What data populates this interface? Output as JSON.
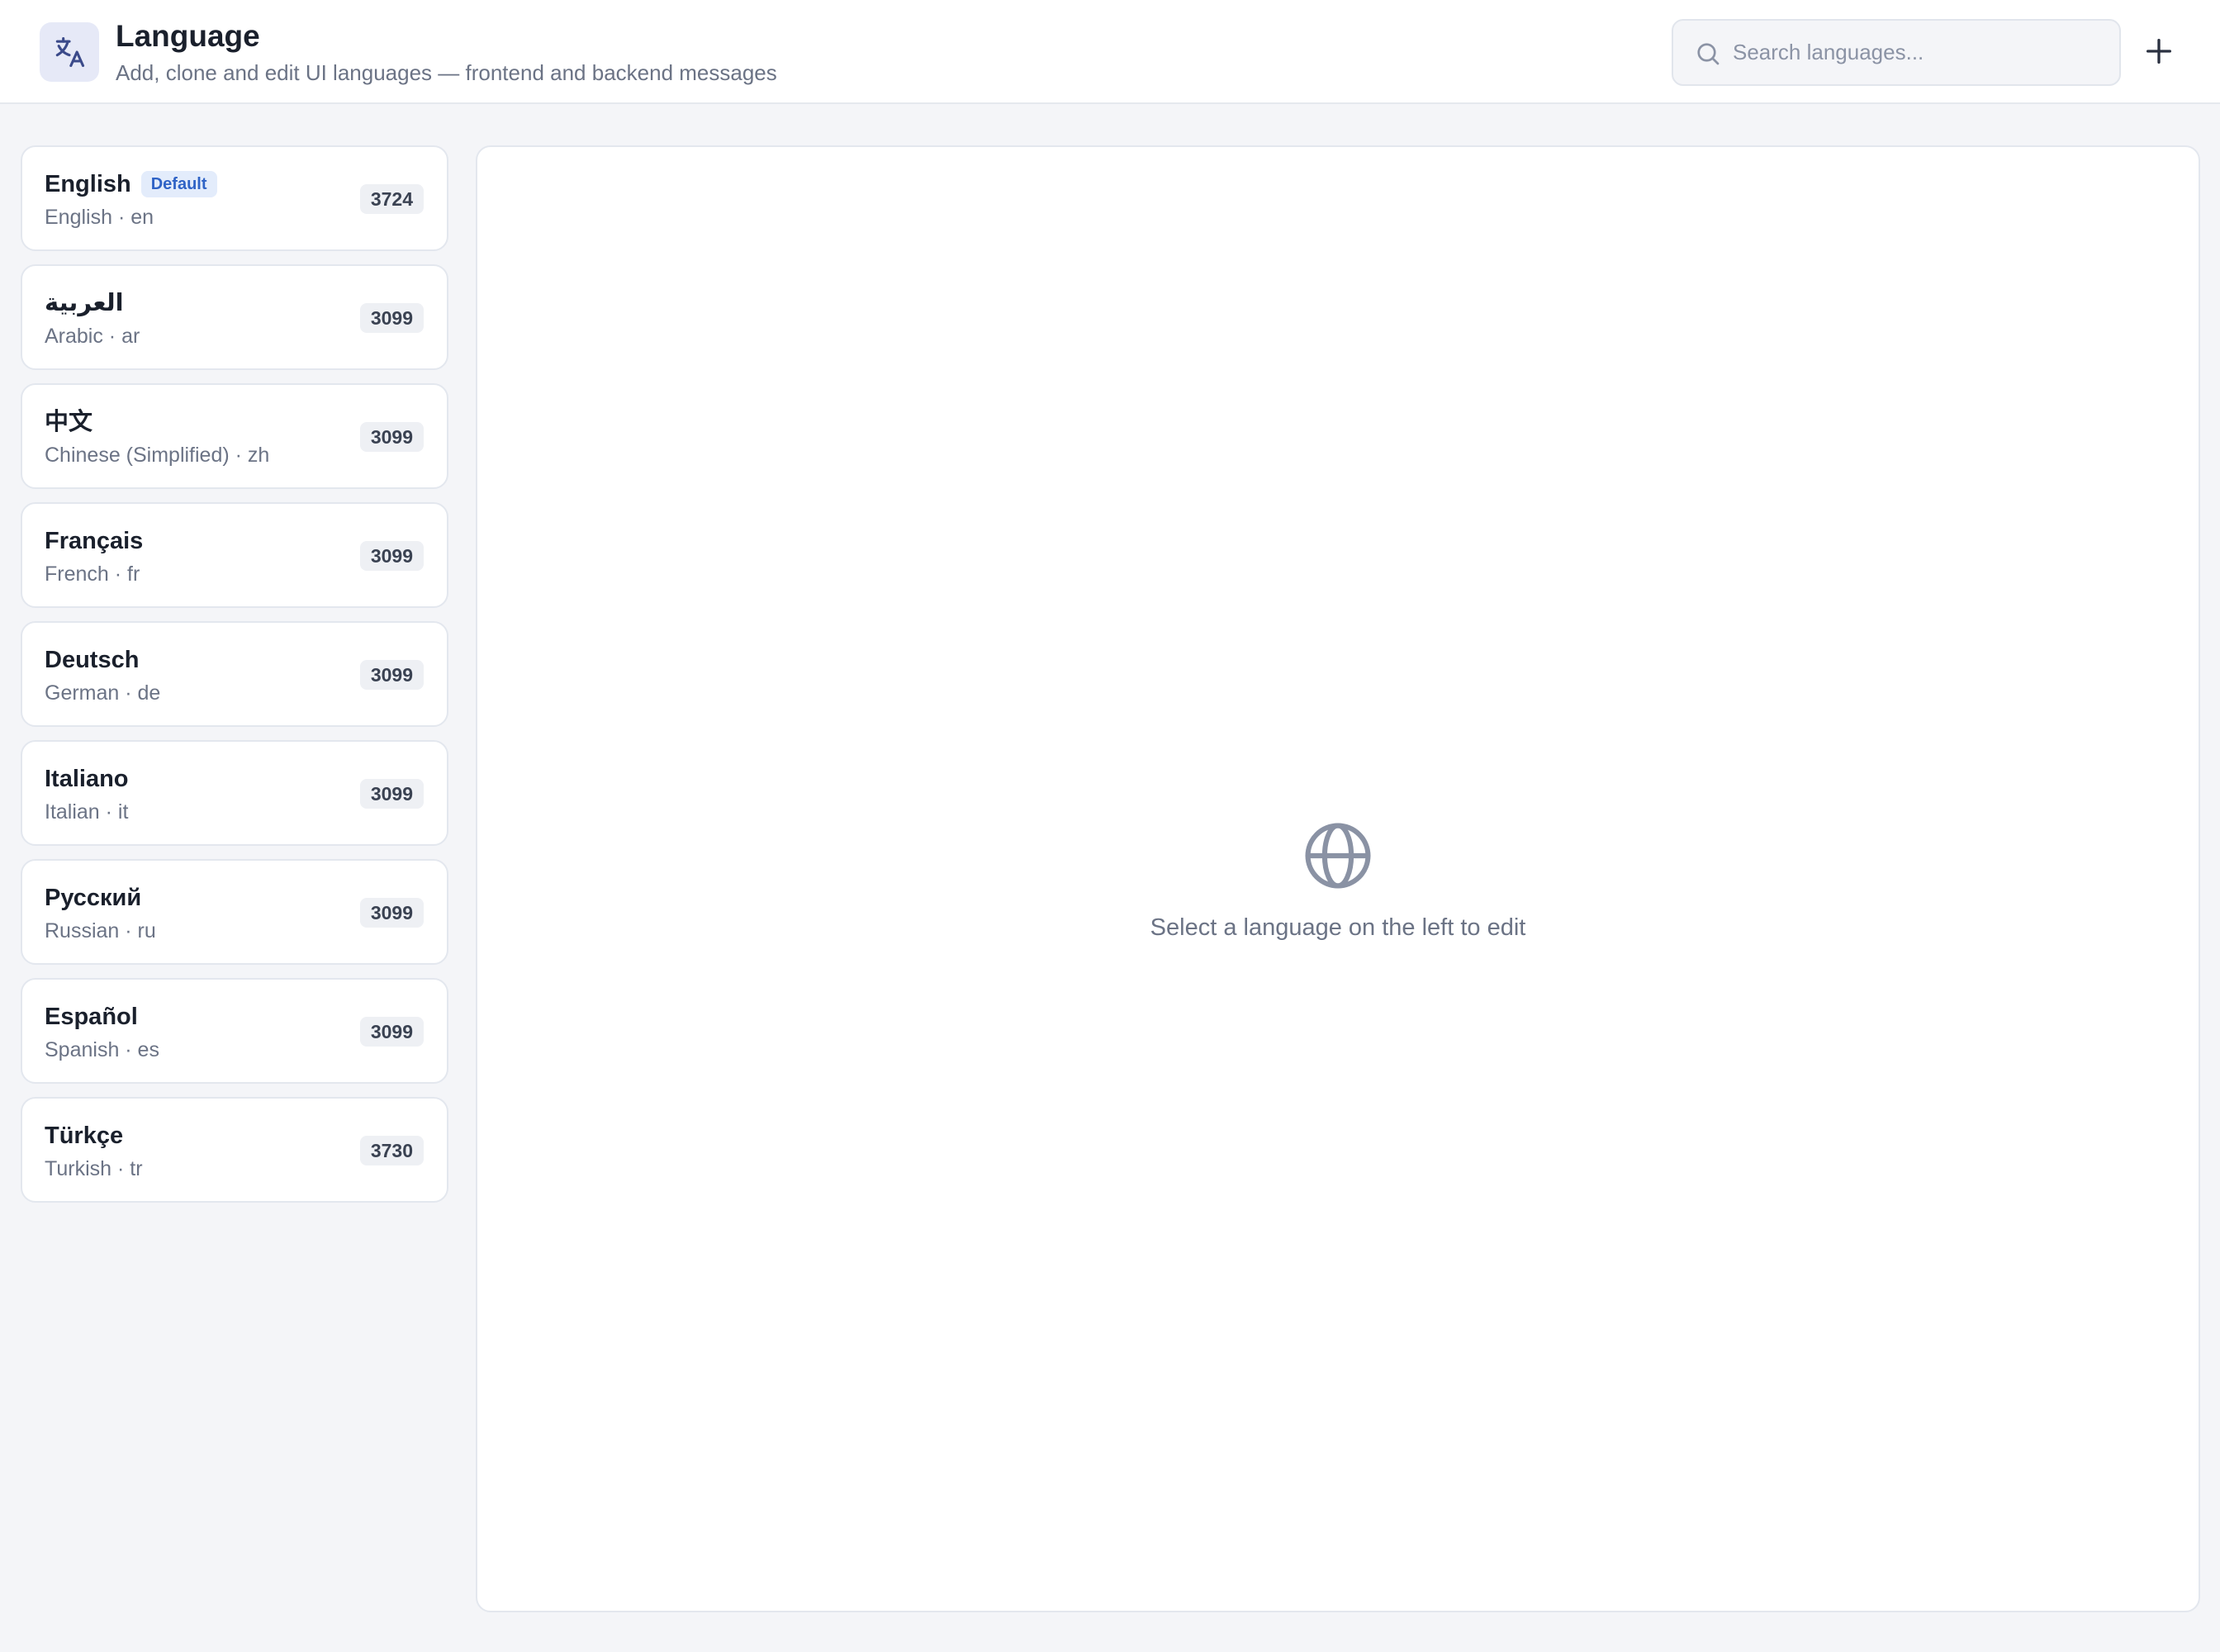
{
  "header": {
    "title": "Language",
    "subtitle": "Add, clone and edit UI languages — frontend and backend messages",
    "icon": "translate-icon",
    "search": {
      "placeholder": "Search languages...",
      "value": ""
    },
    "add_icon": "plus-icon"
  },
  "languages": [
    {
      "native": "English",
      "meta": "English · en",
      "count": "3724",
      "badge": "Default"
    },
    {
      "native": "العربية",
      "meta": "Arabic · ar",
      "count": "3099"
    },
    {
      "native": "中文",
      "meta": "Chinese (Simplified) · zh",
      "count": "3099"
    },
    {
      "native": "Français",
      "meta": "French · fr",
      "count": "3099"
    },
    {
      "native": "Deutsch",
      "meta": "German · de",
      "count": "3099"
    },
    {
      "native": "Italiano",
      "meta": "Italian · it",
      "count": "3099"
    },
    {
      "native": "Русский",
      "meta": "Russian · ru",
      "count": "3099"
    },
    {
      "native": "Español",
      "meta": "Spanish · es",
      "count": "3099"
    },
    {
      "native": "Türkçe",
      "meta": "Turkish · tr",
      "count": "3730"
    }
  ],
  "main": {
    "empty_icon": "globe-icon",
    "empty_message": "Select a language on the left to edit"
  },
  "colors": {
    "accent": "#2f63c6",
    "badge_bg": "#e3ecfb",
    "icon_bg": "#e6e9f7",
    "page_bg": "#f4f5f8"
  }
}
